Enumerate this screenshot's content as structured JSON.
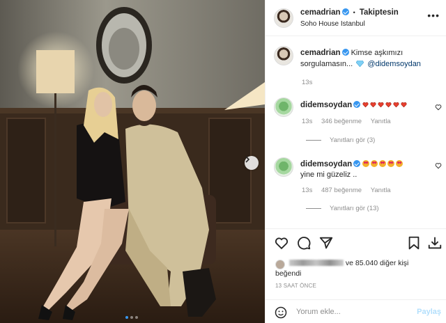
{
  "header": {
    "username": "cemadrian",
    "follow_label": "Takiptesin",
    "separator": "•",
    "location": "Soho House Istanbul"
  },
  "caption": {
    "username": "cemadrian",
    "text": "Kimse aşkımızı sorgulamasın...",
    "mention": "@didemsoydan",
    "time": "13s"
  },
  "comments": [
    {
      "username": "didemsoydan",
      "text": "",
      "emoji": "heart-emoji",
      "emoji_count": 6,
      "time": "13s",
      "likes": "346 beğenme",
      "reply_label": "Yanıtla",
      "view_replies": "Yanıtları gör (3)"
    },
    {
      "username": "didemsoydan",
      "emoji": "heart-eyes-emoji",
      "emoji_count": 5,
      "text": "yine mi güzeliz ..",
      "time": "13s",
      "likes": "487 beğenme",
      "reply_label": "Yanıtla",
      "view_replies": "Yanıtları gör (13)"
    }
  ],
  "likes_line": {
    "suffix": "ve 85.040 diğer kişi",
    "second_line": "beğendi"
  },
  "time_ago": "13 SAAT ÖNCE",
  "comment_box": {
    "placeholder": "Yorum ekle...",
    "post_label": "Paylaş"
  },
  "icons": [
    "heart-icon",
    "comment-icon",
    "share-icon",
    "bookmark-icon",
    "download-icon",
    "emoji-icon",
    "more-icon",
    "chevron-right-icon",
    "verified-icon"
  ],
  "colors": {
    "verified": "#3897f0",
    "link": "#00376b",
    "muted": "#8e8e8e",
    "post_disabled": "#b2dffc"
  }
}
